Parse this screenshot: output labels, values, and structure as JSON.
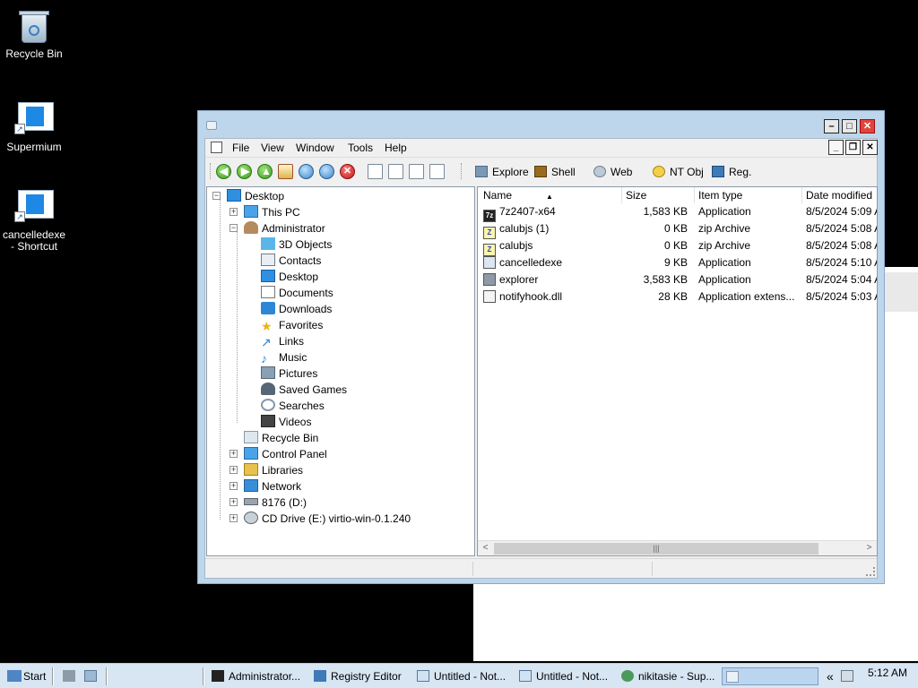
{
  "desktop": {
    "icons": [
      {
        "label": "Recycle Bin"
      },
      {
        "label": "Supermium"
      },
      {
        "label": "cancelledexe - Shortcut"
      }
    ]
  },
  "window": {
    "menu": [
      "File",
      "View",
      "Window",
      "Tools",
      "Help"
    ],
    "toolbar": {
      "explore": "Explore",
      "shell": "Shell",
      "web": "Web",
      "ntobj": "NT Obj",
      "reg": "Reg."
    },
    "tree": {
      "root": "Desktop",
      "this_pc": "This PC",
      "administrator": "Administrator",
      "admin_children": [
        "3D Objects",
        "Contacts",
        "Desktop",
        "Documents",
        "Downloads",
        "Favorites",
        "Links",
        "Music",
        "Pictures",
        "Saved Games",
        "Searches",
        "Videos"
      ],
      "recycle_bin": "Recycle Bin",
      "control_panel": "Control Panel",
      "libraries": "Libraries",
      "network": "Network",
      "drive_d": "8176 (D:)",
      "drive_e": "CD Drive (E:) virtio-win-0.1.240"
    },
    "columns": [
      "Name",
      "Size",
      "Item type",
      "Date modified"
    ],
    "files": [
      {
        "name": "7z2407-x64",
        "size": "1,583 KB",
        "type": "Application",
        "date": "8/5/2024 5:09 A",
        "icon": "7z-icon"
      },
      {
        "name": "calubjs (1)",
        "size": "0 KB",
        "type": "zip Archive",
        "date": "8/5/2024 5:08 A",
        "icon": "zip-icon"
      },
      {
        "name": "calubjs",
        "size": "0 KB",
        "type": "zip Archive",
        "date": "8/5/2024 5:08 A",
        "icon": "zip-icon"
      },
      {
        "name": "cancelledexe",
        "size": "9 KB",
        "type": "Application",
        "date": "8/5/2024 5:10 A",
        "icon": "app-icon"
      },
      {
        "name": "explorer",
        "size": "3,583 KB",
        "type": "Application",
        "date": "8/5/2024 5:04 A",
        "icon": "app-icon"
      },
      {
        "name": "notifyhook.dll",
        "size": "28 KB",
        "type": "Application extens...",
        "date": "8/5/2024 5:03 A",
        "icon": "dll-icon"
      }
    ]
  },
  "taskbar": {
    "start": "Start",
    "tasks": [
      "Administrator...",
      "Registry Editor",
      "Untitled - Not...",
      "Untitled - Not...",
      "nikitasie - Sup..."
    ],
    "clock": "5:12 AM",
    "tray_chevron": "«"
  }
}
